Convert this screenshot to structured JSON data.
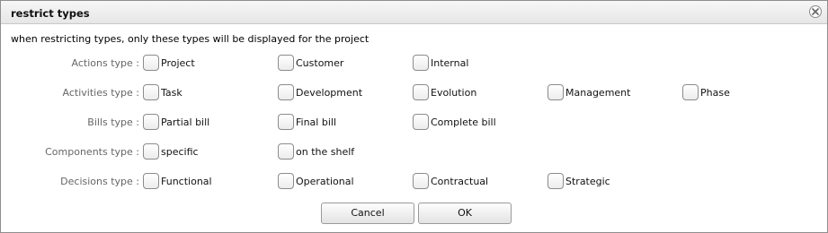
{
  "dialog": {
    "title": "restrict types",
    "intro": "when restricting types, only these types will be displayed for the project"
  },
  "rows": [
    {
      "label": "Actions type :",
      "options": [
        "Project",
        "Customer",
        "Internal"
      ]
    },
    {
      "label": "Activities type :",
      "options": [
        "Task",
        "Development",
        "Evolution",
        "Management",
        "Phase"
      ]
    },
    {
      "label": "Bills type :",
      "options": [
        "Partial bill",
        "Final bill",
        "Complete bill"
      ]
    },
    {
      "label": "Components type :",
      "options": [
        "specific",
        "on the shelf"
      ]
    },
    {
      "label": "Decisions type :",
      "options": [
        "Functional",
        "Operational",
        "Contractual",
        "Strategic"
      ]
    }
  ],
  "buttons": {
    "cancel": "Cancel",
    "ok": "OK"
  },
  "icons": {
    "close": "close-icon",
    "checkbox": "checkbox-unchecked"
  }
}
